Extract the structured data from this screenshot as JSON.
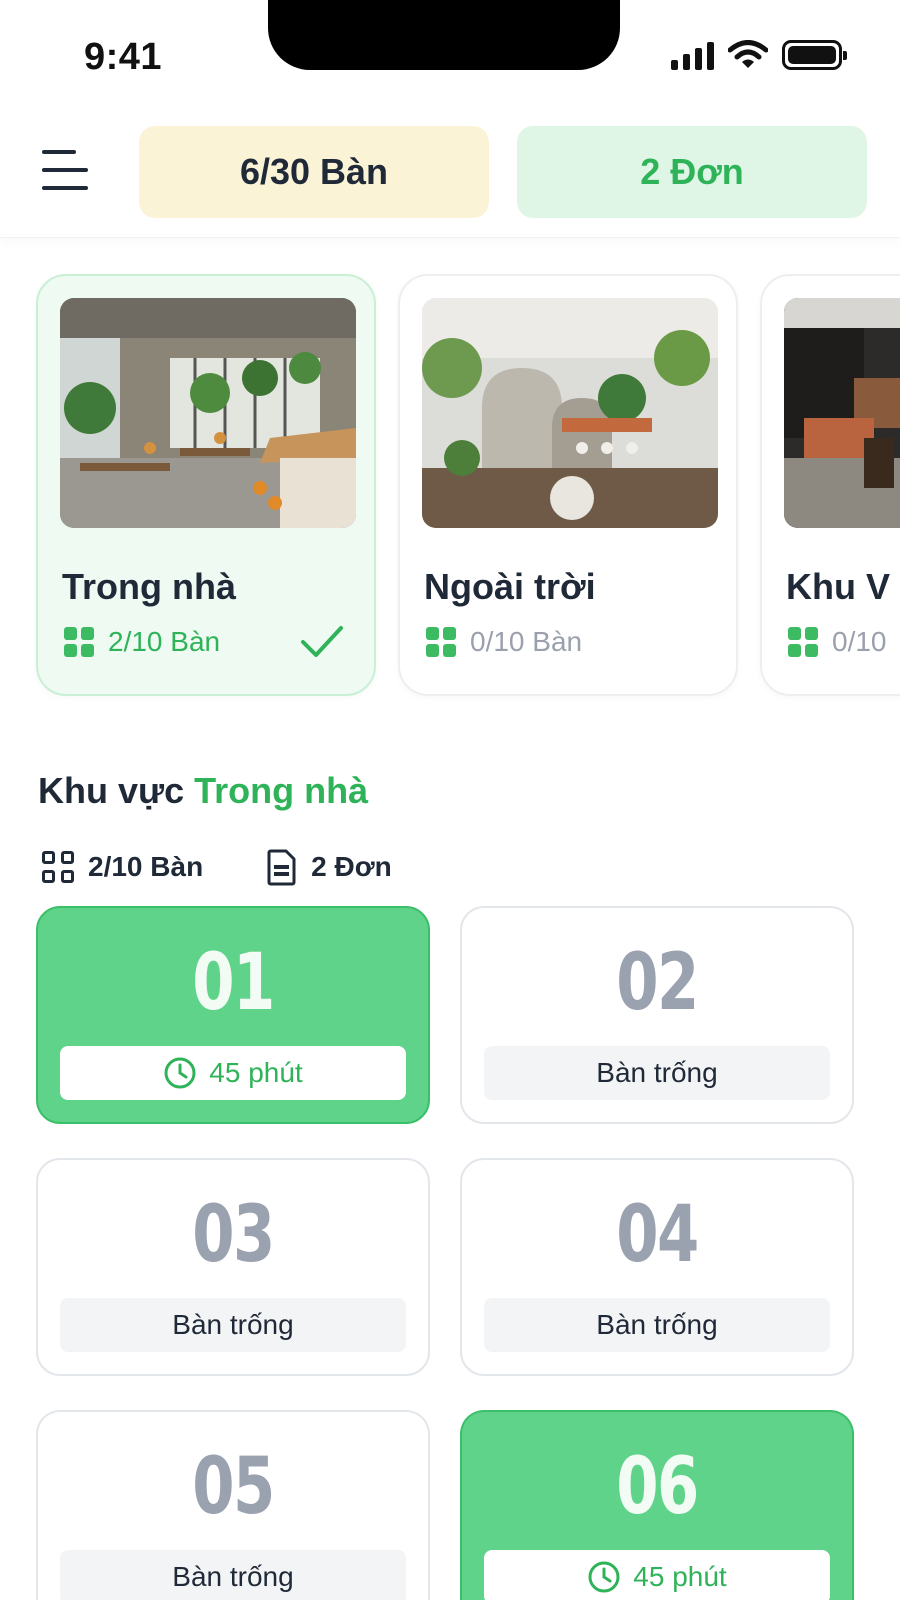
{
  "status_bar": {
    "time": "9:41"
  },
  "header": {
    "tables_summary": "6/30 Bàn",
    "orders_summary": "2 Đơn"
  },
  "areas": [
    {
      "name": "Trong nhà",
      "count": "2/10 Bàn",
      "selected": true
    },
    {
      "name": "Ngoài trời",
      "count": "0/10 Bàn",
      "selected": false
    },
    {
      "name": "Khu V",
      "count": "0/10",
      "selected": false
    }
  ],
  "section": {
    "prefix": "Khu vực",
    "area_name": "Trong nhà",
    "tables_count": "2/10 Bàn",
    "orders_count": "2 Đơn"
  },
  "tables": [
    {
      "number": "01",
      "status": "45 phút",
      "occupied": true
    },
    {
      "number": "02",
      "status": "Bàn trống",
      "occupied": false
    },
    {
      "number": "03",
      "status": "Bàn trống",
      "occupied": false
    },
    {
      "number": "04",
      "status": "Bàn trống",
      "occupied": false
    },
    {
      "number": "05",
      "status": "Bàn trống",
      "occupied": false
    },
    {
      "number": "06",
      "status": "45 phút",
      "occupied": true
    }
  ],
  "colors": {
    "accent_green": "#2fb359",
    "occupied_tile": "#5fd38a",
    "tables_pill": "#fbf3d6",
    "orders_pill": "#dff5e6"
  },
  "icons": [
    "menu-icon",
    "signal-icon",
    "wifi-icon",
    "battery-icon",
    "grid-icon",
    "check-icon",
    "document-icon",
    "clock-icon"
  ]
}
